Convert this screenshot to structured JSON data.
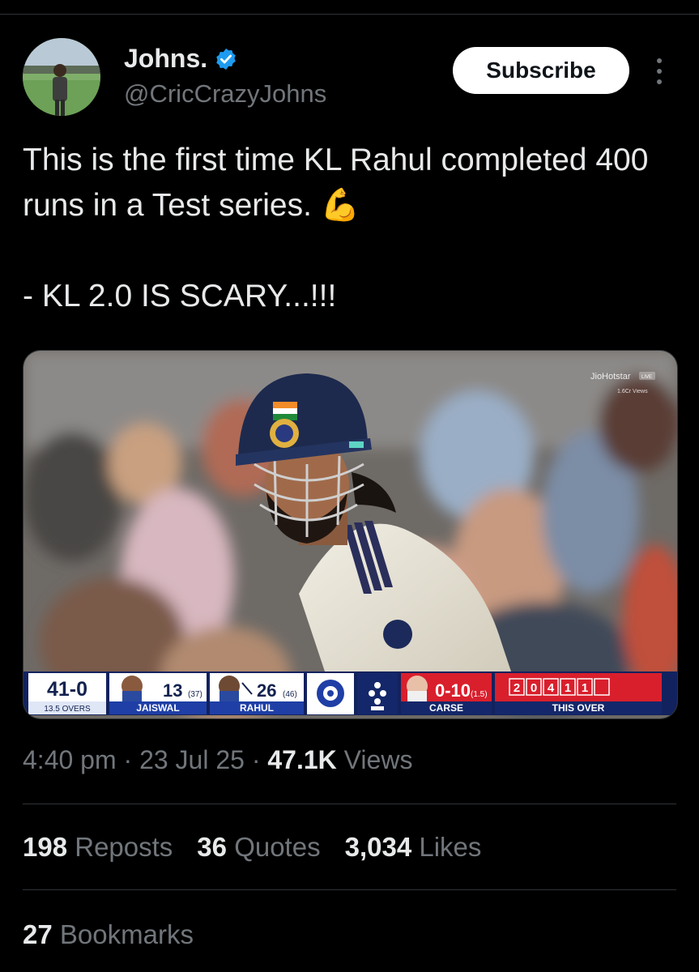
{
  "author": {
    "name": "Johns.",
    "handle": "@CricCrazyJohns",
    "verified": true
  },
  "subscribe_label": "Subscribe",
  "tweet": {
    "text": "This is the first time KL Rahul completed 400 runs in a Test series. 💪\n\n- KL 2.0 IS SCARY...!!!"
  },
  "media": {
    "broadcaster": "JioHotstar",
    "live_label": "LIVE",
    "views_label": "1.6Cr Views",
    "scorebug": {
      "score": "41-0",
      "overs": "13.5 OVERS",
      "batter1_runs": "13",
      "batter1_balls": "(37)",
      "batter1_name": "JAISWAL",
      "batter2_runs": "26",
      "batter2_balls": "(46)",
      "batter2_name": "RAHUL",
      "bowler_figures": "0-10",
      "bowler_overs": "(1.5)",
      "bowler_name": "CARSE",
      "this_over_balls": [
        "2",
        "0",
        "4",
        "1",
        "1",
        ""
      ],
      "this_over_label": "THIS OVER"
    }
  },
  "meta": {
    "time": "4:40 pm",
    "date": "23 Jul 25",
    "views_count": "47.1K",
    "views_label": "Views"
  },
  "stats": {
    "reposts_count": "198",
    "reposts_label": "Reposts",
    "quotes_count": "36",
    "quotes_label": "Quotes",
    "likes_count": "3,034",
    "likes_label": "Likes",
    "bookmarks_count": "27",
    "bookmarks_label": "Bookmarks"
  },
  "colors": {
    "background": "#000000",
    "text_primary": "#e7e9ea",
    "text_secondary": "#71767b",
    "divider": "#2f3336",
    "verified_blue": "#1d9bf0",
    "scorebug_blue": "#1f3fa6",
    "scorebug_red": "#d91f2c"
  }
}
